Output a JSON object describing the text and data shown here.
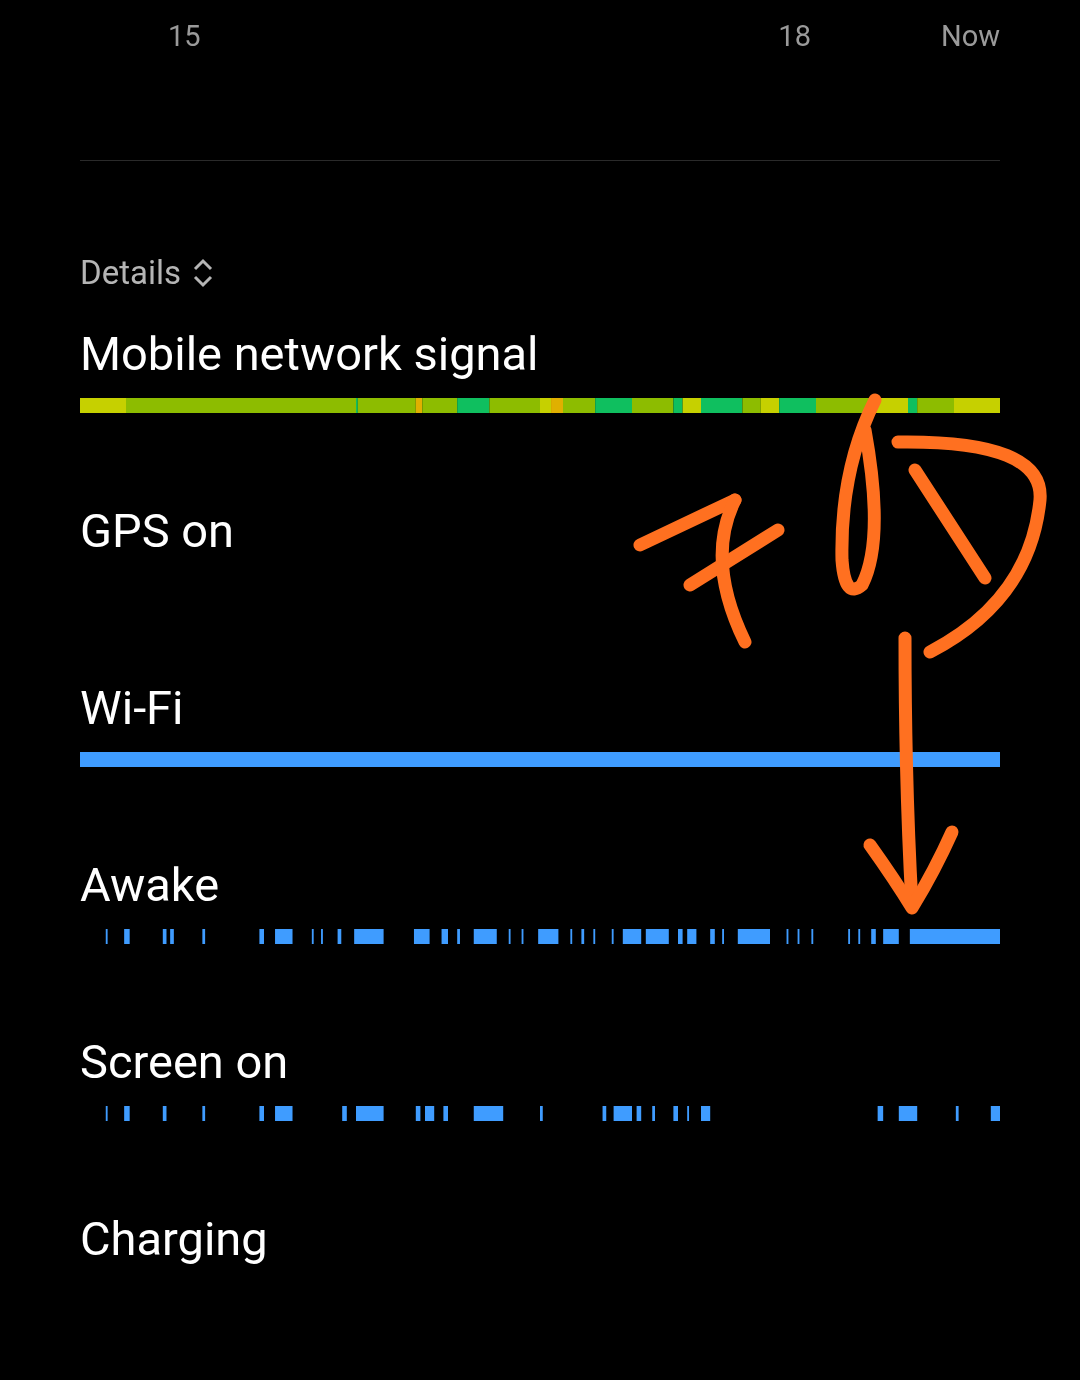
{
  "axis": {
    "ticks": [
      "15",
      "18",
      "Now"
    ]
  },
  "details": {
    "label": "Details"
  },
  "rows": [
    {
      "title": "Mobile network signal",
      "kind": "signal"
    },
    {
      "title": "GPS on",
      "kind": "none"
    },
    {
      "title": "Wi-Fi",
      "kind": "solid"
    },
    {
      "title": "Awake",
      "kind": "awake"
    },
    {
      "title": "Screen on",
      "kind": "screen"
    },
    {
      "title": "Charging",
      "kind": "none"
    }
  ]
}
